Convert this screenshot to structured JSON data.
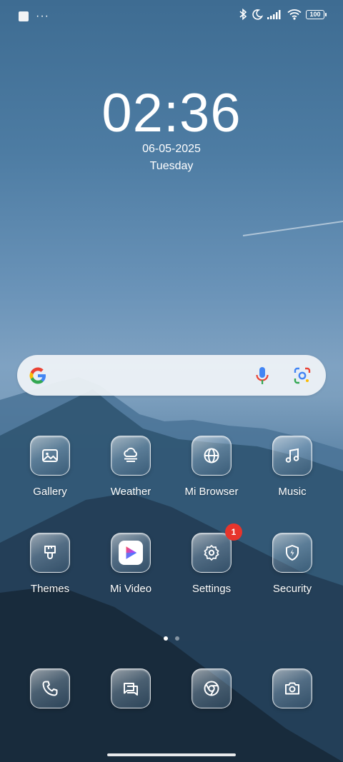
{
  "status_bar": {
    "icons": [
      "notification-square-icon",
      "more-dots-icon",
      "bluetooth-icon",
      "do-not-disturb-moon-icon",
      "cellular-signal-icon",
      "wifi-icon",
      "battery-icon"
    ],
    "more_label": "···",
    "battery_level": "100"
  },
  "lockscreen": {
    "time": "02:36",
    "date": "06-05-2025",
    "day": "Tuesday"
  },
  "search_widget": {
    "icons": [
      "google-g-icon",
      "microphone-icon",
      "google-lens-icon"
    ]
  },
  "apps": [
    {
      "label": "Gallery",
      "icon": "gallery-icon"
    },
    {
      "label": "Weather",
      "icon": "weather-icon"
    },
    {
      "label": "Mi Browser",
      "icon": "globe-icon"
    },
    {
      "label": "Music",
      "icon": "music-note-icon"
    },
    {
      "label": "Themes",
      "icon": "paintbrush-icon"
    },
    {
      "label": "Mi Video",
      "icon": "play-icon"
    },
    {
      "label": "Settings",
      "icon": "gear-icon",
      "badge": "1"
    },
    {
      "label": "Security",
      "icon": "shield-icon"
    }
  ],
  "pager": {
    "pages": 2,
    "current": 1
  },
  "dock": [
    {
      "icon": "phone-icon"
    },
    {
      "icon": "messages-icon"
    },
    {
      "icon": "chrome-icon"
    },
    {
      "icon": "camera-icon"
    }
  ],
  "colors": {
    "sky_top": "#3e6c92",
    "badge": "#e7352c",
    "search_bg": "#f0f4f8"
  }
}
